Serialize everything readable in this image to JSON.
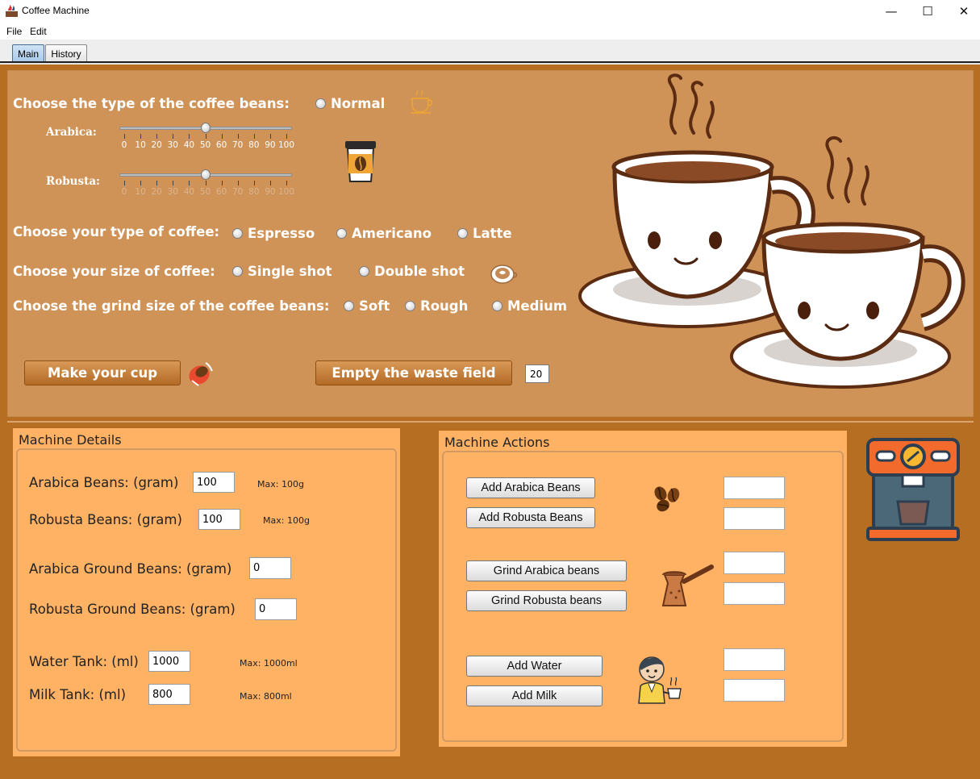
{
  "window": {
    "title": "Coffee Machine",
    "minimize": "—",
    "maximize": "☐",
    "close": "✕"
  },
  "menu": {
    "items": [
      "File",
      "Edit"
    ]
  },
  "tabs": [
    {
      "label": "Main",
      "active": true
    },
    {
      "label": "History",
      "active": false
    }
  ],
  "beans": {
    "label": "Choose the type of the coffee beans:",
    "normal": "Normal",
    "arabica_label": "Arabica:",
    "robusta_label": "Robusta:",
    "arabica_value": 50,
    "robusta_value": 50,
    "ticks": [
      "0",
      "10",
      "20",
      "30",
      "40",
      "50",
      "60",
      "70",
      "80",
      "90",
      "100"
    ]
  },
  "coffee_type": {
    "label": "Choose your type of coffee:",
    "options": [
      "Espresso",
      "Americano",
      "Latte"
    ]
  },
  "coffee_size": {
    "label": "Choose your size of coffee:",
    "options": [
      "Single shot",
      "Double shot"
    ]
  },
  "grind": {
    "label": "Choose the grind size of the coffee beans:",
    "options": [
      "Soft",
      "Rough",
      "Medium"
    ]
  },
  "actions": {
    "make_cup": "Make your cup",
    "empty_waste": "Empty the waste field",
    "waste_value": "20"
  },
  "machine_details": {
    "title": "Machine Details",
    "arabica_beans": {
      "label": "Arabica Beans: (gram)",
      "value": "100",
      "max": "Max: 100g"
    },
    "robusta_beans": {
      "label": "Robusta Beans: (gram)",
      "value": "100",
      "max": "Max: 100g"
    },
    "arabica_ground": {
      "label": "Arabica Ground Beans: (gram)",
      "value": "0"
    },
    "robusta_ground": {
      "label": "Robusta Ground Beans: (gram)",
      "value": "0"
    },
    "water": {
      "label": "Water Tank: (ml)",
      "value": "1000",
      "max": "Max: 1000ml"
    },
    "milk": {
      "label": "Milk Tank: (ml)",
      "value": "800",
      "max": "Max: 800ml"
    }
  },
  "machine_actions": {
    "title": "Machine Actions",
    "add_arabica": "Add Arabica Beans",
    "add_robusta": "Add Robusta Beans",
    "grind_arabica": "Grind Arabica beans",
    "grind_robusta": "Grind Robusta beans",
    "add_water": "Add Water",
    "add_milk": "Add Milk"
  },
  "colors": {
    "panel": "#b66f22",
    "top_panel": "#cf9257",
    "box": "#ffb264",
    "button": "#c07a36"
  }
}
